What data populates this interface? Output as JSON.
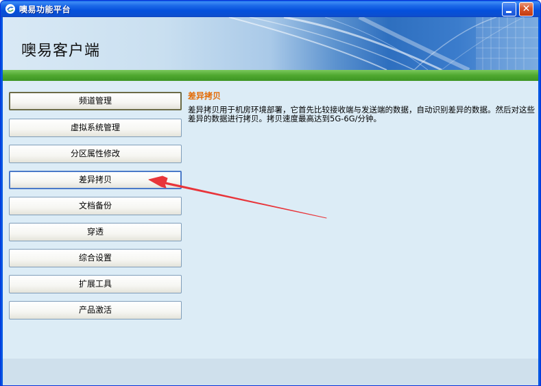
{
  "window": {
    "title": "噢易功能平台",
    "icon": "app-icon",
    "minimize_icon": "minimize-icon",
    "close_icon": "close-icon"
  },
  "banner": {
    "title": "噢易客户端"
  },
  "menu": {
    "items": [
      {
        "label": "频道管理"
      },
      {
        "label": "虚拟系统管理"
      },
      {
        "label": "分区属性修改"
      },
      {
        "label": "差异拷贝"
      },
      {
        "label": "文档备份"
      },
      {
        "label": "穿透"
      },
      {
        "label": "综合设置"
      },
      {
        "label": "扩展工具"
      },
      {
        "label": "产品激活"
      }
    ],
    "selected": "差异拷贝"
  },
  "detail": {
    "title": "差异拷贝",
    "description": "差异拷贝用于机房环境部署，它首先比较接收端与发送端的数据，自动识别差异的数据。然后对这些差异的数据进行拷贝。拷贝速度最高达到5G-6G/分钟。"
  },
  "colors": {
    "title_accent": "#e36b07",
    "green_bar": "#4fa82f",
    "client_bg": "#dcecf6",
    "arrow": "#e8353a"
  }
}
